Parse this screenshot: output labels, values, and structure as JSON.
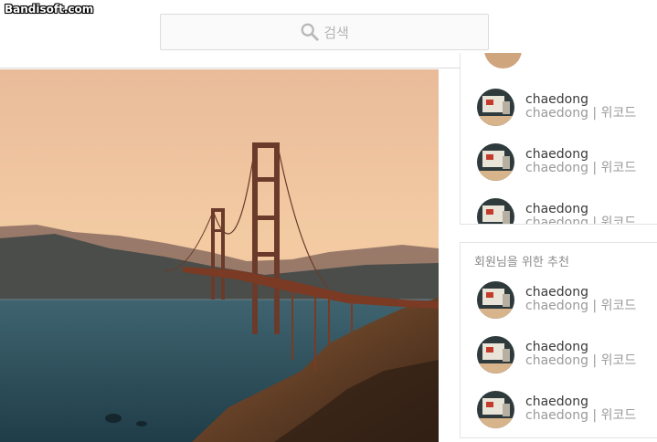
{
  "watermark": "Bandisoft.com",
  "search": {
    "placeholder": "검색"
  },
  "feed_photo": {
    "subject": "suspension bridge at sunset"
  },
  "recommend_top": {
    "users": [
      {
        "name": "chaedong",
        "sub": "chaedong | 위코드"
      },
      {
        "name": "chaedong",
        "sub": "chaedong | 위코드"
      },
      {
        "name": "chaedong",
        "sub": "chaedong | 위코드"
      }
    ]
  },
  "recommend_bottom": {
    "title": "회원님을 위한 추천",
    "users": [
      {
        "name": "chaedong",
        "sub": "chaedong | 위코드"
      },
      {
        "name": "chaedong",
        "sub": "chaedong | 위코드"
      },
      {
        "name": "chaedong",
        "sub": "chaedong | 위코드"
      }
    ]
  }
}
